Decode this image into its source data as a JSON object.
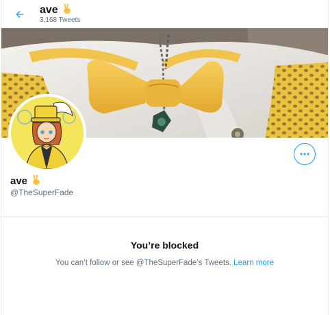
{
  "header": {
    "name": "ave",
    "tweets_count": "3,168 Tweets",
    "back_icon": "arrow-left-icon",
    "name_emoji": "victory-hand-icon"
  },
  "profile": {
    "name": "ave",
    "handle": "@TheSuperFade",
    "more_icon": "ellipsis-icon"
  },
  "blocked": {
    "title": "You’re blocked",
    "message": "You can’t follow or see @TheSuperFade’s Tweets.",
    "link": "Learn more"
  },
  "colors": {
    "accent": "#1d9bf0",
    "secondary_text": "#5b7083",
    "banner_bowtie": "#f2c14a",
    "avatar_bg": "#f7e35a"
  }
}
